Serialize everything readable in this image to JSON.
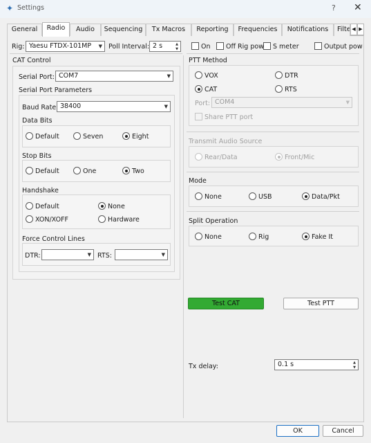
{
  "window": {
    "title": "Settings",
    "help": "?",
    "close": "✕"
  },
  "tabs": [
    {
      "label": "General"
    },
    {
      "label": "Radio"
    },
    {
      "label": "Audio"
    },
    {
      "label": "Sequencing"
    },
    {
      "label": "Tx Macros"
    },
    {
      "label": "Reporting"
    },
    {
      "label": "Frequencies"
    },
    {
      "label": "Notifications"
    },
    {
      "label": "Filte"
    }
  ],
  "top_row": {
    "rig_label": "Rig:",
    "rig_value": "Yaesu FTDX-101MP",
    "poll_label": "Poll Interval:",
    "poll_value": "2 s",
    "on_label": "On",
    "off_rig_pow_label": "Off Rig pow",
    "s_meter_label": "S meter",
    "output_pow_label": "Output pow"
  },
  "cat": {
    "title": "CAT Control",
    "serial_port_label": "Serial Port:",
    "serial_port_value": "COM7",
    "params_title": "Serial Port Parameters",
    "baud_label": "Baud Rate:",
    "baud_value": "38400",
    "data_bits_title": "Data Bits",
    "data_bits": [
      "Default",
      "Seven",
      "Eight"
    ],
    "stop_bits_title": "Stop Bits",
    "stop_bits": [
      "Default",
      "One",
      "Two"
    ],
    "handshake_title": "Handshake",
    "handshake": [
      "Default",
      "None",
      "XON/XOFF",
      "Hardware"
    ],
    "force_title": "Force Control Lines",
    "dtr_label": "DTR:",
    "rts_label": "RTS:"
  },
  "ptt": {
    "title": "PTT Method",
    "options": [
      "VOX",
      "DTR",
      "CAT",
      "RTS"
    ],
    "port_label": "Port:",
    "port_value": "COM4",
    "share_label": "Share PTT port"
  },
  "audio": {
    "title": "Transmit Audio Source",
    "options": [
      "Rear/Data",
      "Front/Mic"
    ]
  },
  "mode": {
    "title": "Mode",
    "options": [
      "None",
      "USB",
      "Data/Pkt"
    ]
  },
  "split": {
    "title": "Split Operation",
    "options": [
      "None",
      "Rig",
      "Fake It"
    ]
  },
  "buttons": {
    "test_cat": "Test CAT",
    "test_ptt": "Test PTT",
    "ok": "OK",
    "cancel": "Cancel"
  },
  "tx_delay": {
    "label": "Tx delay:",
    "value": "0.1 s"
  },
  "colors": {
    "test_cat_bg": "#33aa33",
    "accent": "#1a6fc4"
  }
}
